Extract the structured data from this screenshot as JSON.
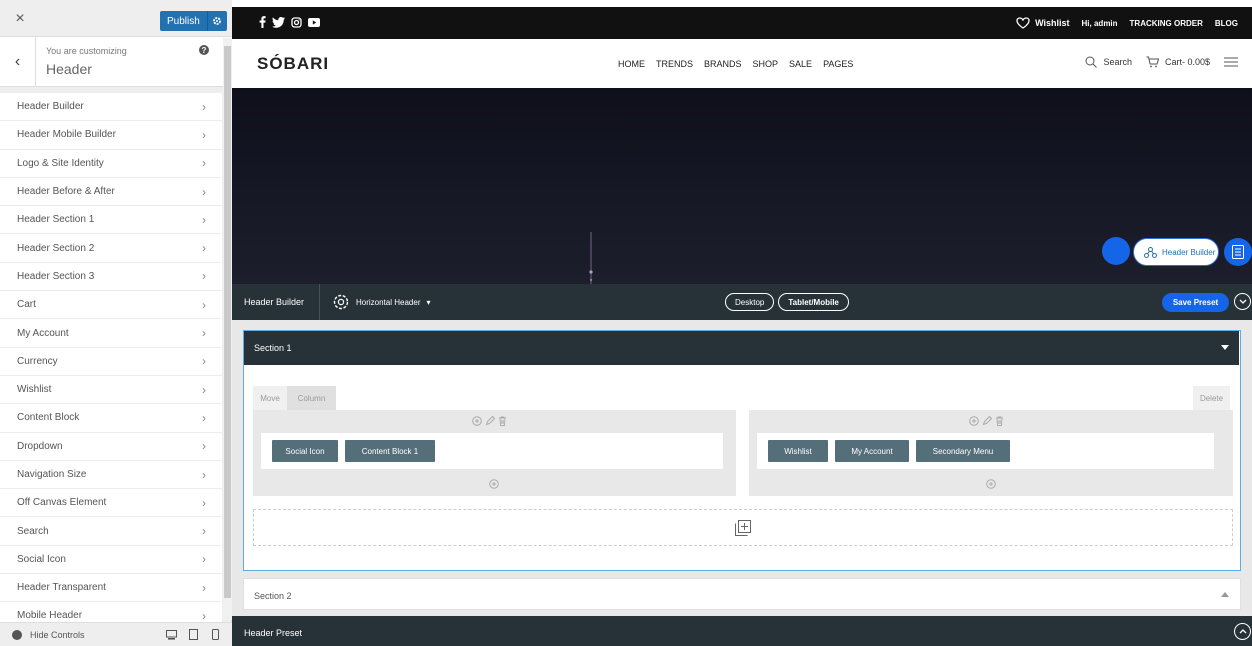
{
  "sidebar": {
    "close_label": "×",
    "publish_label": "Publish",
    "customizing_label": "You are customizing",
    "customizing_title": "Header",
    "back_glyph": "‹",
    "help_glyph": "?",
    "items": [
      {
        "label": "Header Builder"
      },
      {
        "label": "Header Mobile Builder"
      },
      {
        "label": "Logo & Site Identity"
      },
      {
        "label": "Header Before & After"
      },
      {
        "label": "Header Section 1"
      },
      {
        "label": "Header Section 2"
      },
      {
        "label": "Header Section 3"
      },
      {
        "label": "Cart"
      },
      {
        "label": "My Account"
      },
      {
        "label": "Currency"
      },
      {
        "label": "Wishlist"
      },
      {
        "label": "Content Block"
      },
      {
        "label": "Dropdown"
      },
      {
        "label": "Navigation Size"
      },
      {
        "label": "Off Canvas Element"
      },
      {
        "label": "Search"
      },
      {
        "label": "Social Icon"
      },
      {
        "label": "Header Transparent"
      },
      {
        "label": "Mobile Header"
      }
    ],
    "chevron": "›",
    "hide_controls": "Hide Controls"
  },
  "site": {
    "wishlist": "Wishlist",
    "greeting": "Hi, admin",
    "tracking": "TRACKING ORDER",
    "blog": "BLOG",
    "logo": "SÓBARI",
    "nav": [
      "HOME",
      "TRENDS",
      "BRANDS",
      "SHOP",
      "SALE",
      "PAGES"
    ],
    "search": "Search",
    "cart": "Cart- 0.00$"
  },
  "floating": {
    "header_builder": "Header Builder"
  },
  "builder": {
    "title": "Header Builder",
    "header_type": "Horizontal Header",
    "dropdown_glyph": "▾",
    "view_desktop": "Desktop",
    "view_tablet": "Tablet/Mobile",
    "save_preset": "Save Preset",
    "section1": {
      "title": "Section 1",
      "tab_move": "Move",
      "tab_column": "Column",
      "delete": "Delete",
      "col1_elements": [
        "Social Icon",
        "Content Block 1"
      ],
      "col2_elements": [
        "Wishlist",
        "My Account",
        "Secondary Menu"
      ]
    },
    "section2": {
      "title": "Section 2"
    },
    "preset_bar": "Header Preset"
  },
  "colors": {
    "accent": "#2271b1",
    "builder_dark": "#263238",
    "element_bg": "#546e7a",
    "highlight_blue": "#1565e8"
  }
}
